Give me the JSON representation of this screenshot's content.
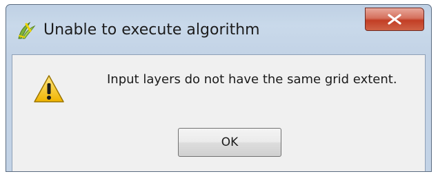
{
  "dialog": {
    "title": "Unable to execute algorithm",
    "app_icon": "qgis-icon",
    "close_icon": "close-icon",
    "message_icon": "warning-icon",
    "message": "Input layers do not have the same grid extent.",
    "ok_label": "OK"
  },
  "colors": {
    "titlebar": "#c3d3e6",
    "close_button": "#c23e25",
    "client_background": "#f0f0f0",
    "warning_yellow": "#f4c430"
  }
}
